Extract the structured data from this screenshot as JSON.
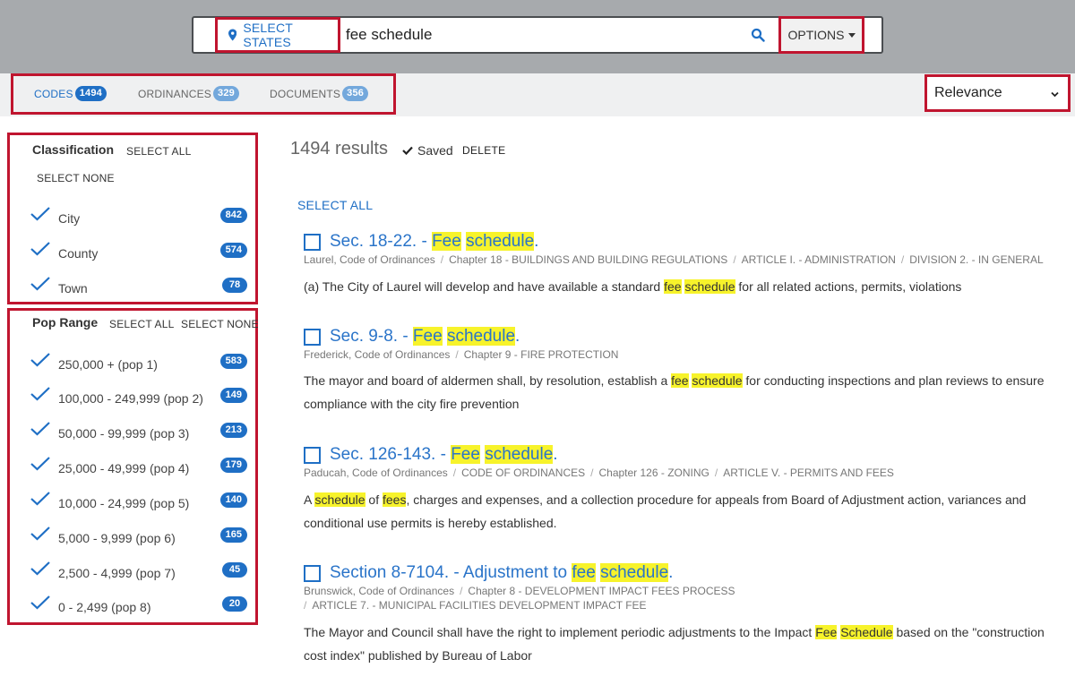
{
  "search": {
    "select_states_label": "SELECT STATES",
    "query": "fee schedule",
    "options_label": "OPTIONS"
  },
  "tabs": [
    {
      "label": "CODES",
      "count": "1494"
    },
    {
      "label": "ORDINANCES",
      "count": "329"
    },
    {
      "label": "DOCUMENTS",
      "count": "356"
    }
  ],
  "sort": {
    "selected": "Relevance"
  },
  "classification": {
    "title": "Classification",
    "select_all": "SELECT ALL",
    "select_none": "SELECT NONE",
    "items": [
      {
        "label": "City",
        "count": "842"
      },
      {
        "label": "County",
        "count": "574"
      },
      {
        "label": "Town",
        "count": "78"
      }
    ]
  },
  "pop_range": {
    "title": "Pop Range",
    "select_all": "SELECT ALL",
    "select_none": "SELECT NONE",
    "items": [
      {
        "label": "250,000 + (pop 1)",
        "count": "583"
      },
      {
        "label": "100,000 - 249,999 (pop 2)",
        "count": "149"
      },
      {
        "label": "50,000 - 99,999 (pop 3)",
        "count": "213"
      },
      {
        "label": "25,000 - 49,999 (pop 4)",
        "count": "179"
      },
      {
        "label": "10,000 - 24,999 (pop 5)",
        "count": "140"
      },
      {
        "label": "5,000 - 9,999 (pop 6)",
        "count": "165"
      },
      {
        "label": "2,500 - 4,999 (pop 7)",
        "count": "45"
      },
      {
        "label": "0 - 2,499 (pop 8)",
        "count": "20"
      }
    ]
  },
  "results": {
    "count_text": "1494 results",
    "saved_label": "Saved",
    "delete_label": "DELETE",
    "select_all_label": "SELECT ALL",
    "items": [
      {
        "title_prefix": "Sec. 18-22. - ",
        "title_hl1": "Fee",
        "title_hl2": "schedule",
        "title_suffix": ".",
        "crumbs": [
          "Laurel, Code of Ordinances",
          "Chapter 18 - BUILDINGS AND BUILDING REGULATIONS",
          "ARTICLE I. - ADMINISTRATION",
          "DIVISION 2. - IN GENERAL"
        ],
        "snippet": [
          "(a) The City of Laurel will develop and have available a standard ",
          "fee",
          " ",
          "schedule",
          " for all related actions, permits, violations"
        ]
      },
      {
        "title_prefix": "Sec. 9-8. - ",
        "title_hl1": "Fee",
        "title_hl2": "schedule",
        "title_suffix": ".",
        "crumbs": [
          "Frederick, Code of Ordinances",
          "Chapter 9 - FIRE PROTECTION"
        ],
        "snippet": [
          "The mayor and board of aldermen shall, by resolution, establish a ",
          "fee",
          " ",
          "schedule",
          " for conducting inspections and plan reviews to ensure compliance with the city fire prevention"
        ]
      },
      {
        "title_prefix": "Sec. 126-143. - ",
        "title_hl1": "Fee",
        "title_hl2": "schedule",
        "title_suffix": ".",
        "crumbs": [
          "Paducah, Code of Ordinances",
          "CODE OF ORDINANCES",
          "Chapter 126 - ZONING",
          "ARTICLE V. - PERMITS AND FEES"
        ],
        "snippet": [
          "A ",
          "schedule",
          " of ",
          "fees",
          ", charges and expenses, and a collection procedure for appeals from Board of Adjustment action, variances and conditional use permits is hereby established."
        ]
      },
      {
        "title_prefix": "Section 8-7104. - Adjustment to ",
        "title_hl1": "fee",
        "title_hl2": "schedule",
        "title_suffix": ".",
        "crumbs": [
          "Brunswick, Code of Ordinances",
          "Chapter 8 - DEVELOPMENT IMPACT FEES PROCESS"
        ],
        "crumbs2": [
          "ARTICLE 7. - MUNICIPAL FACILITIES DEVELOPMENT IMPACT FEE"
        ],
        "snippet": [
          "The Mayor and Council shall have the right to implement periodic adjustments to the Impact ",
          "Fee",
          " ",
          "Schedule",
          " based on the \"construction cost index\" published by Bureau of Labor"
        ]
      }
    ]
  },
  "colors": {
    "accent": "#1f6fc5",
    "highlight": "#f7f32b",
    "annotation_border": "#c0152f",
    "header_bg": "#a7aaad"
  }
}
